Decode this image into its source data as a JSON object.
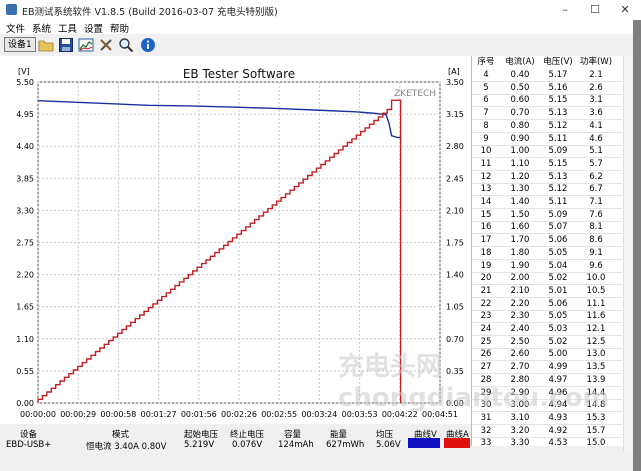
{
  "window": {
    "title": "EB测试系统软件 V1.8.5 (Build 2016-03-07 充电头特别版)",
    "controls": [
      "–",
      "☐",
      "✕"
    ]
  },
  "menu": [
    "文件",
    "系统",
    "工具",
    "设置",
    "帮助"
  ],
  "toolbar": {
    "device_button": "设备1",
    "icons": [
      "folder-icon",
      "save-icon",
      "chart-icon",
      "tools-icon",
      "zoom-icon",
      "info-icon"
    ]
  },
  "chart_data": {
    "type": "line",
    "title": "EB Tester Software",
    "watermark": "ZKETECH",
    "left_unit": "[V]",
    "right_unit": "[A]",
    "y_left_ticks": [
      "5.50",
      "4.95",
      "4.40",
      "3.85",
      "3.30",
      "2.75",
      "2.20",
      "1.65",
      "1.10",
      "0.55",
      "0.00"
    ],
    "y_right_ticks": [
      "3.50",
      "3.15",
      "2.80",
      "2.45",
      "2.10",
      "1.75",
      "1.40",
      "1.05",
      "0.70",
      "0.35",
      "0.00"
    ],
    "x_ticks": [
      "00:00:00",
      "00:00:29",
      "00:00:58",
      "00:01:27",
      "00:01:56",
      "00:02:26",
      "00:02:55",
      "00:03:24",
      "00:03:53",
      "00:04:22",
      "00:04:51"
    ],
    "ylim_left": [
      0,
      5.5
    ],
    "ylim_right": [
      0,
      3.5
    ],
    "xlim_seconds": [
      0,
      291
    ],
    "grid": true,
    "series": [
      {
        "color": "#1f2fa0",
        "axis": "left",
        "x": [
          0,
          20,
          50,
          80,
          110,
          140,
          170,
          200,
          230,
          245,
          252,
          254,
          256,
          260,
          263
        ],
        "values": [
          5.18,
          5.16,
          5.13,
          5.1,
          5.09,
          5.07,
          5.05,
          5.02,
          4.99,
          4.96,
          4.94,
          4.8,
          4.58,
          4.55,
          4.55
        ]
      },
      {
        "color": "#c02020",
        "axis": "right",
        "step_current": true,
        "x": [
          0,
          3.2,
          6.4,
          9.6,
          12.8,
          16.0,
          19.2,
          22.4,
          25.6,
          28.8,
          32.0,
          35.2,
          38.4,
          41.6,
          44.8,
          48.0,
          51.2,
          54.4,
          57.6,
          60.8,
          64.0,
          67.2,
          70.4,
          73.6,
          76.8,
          80.0,
          83.2,
          86.4,
          89.6,
          92.8,
          96.0,
          99.2,
          102.4,
          105.6,
          108.8,
          112.0,
          115.2,
          118.4,
          121.6,
          124.8,
          128.0,
          131.2,
          134.4,
          137.6,
          140.8,
          144.0,
          147.2,
          150.4,
          153.6,
          156.8,
          160.0,
          163.2,
          166.4,
          169.6,
          172.8,
          176.0,
          179.2,
          182.4,
          185.6,
          188.8,
          192.0,
          195.2,
          198.4,
          201.6,
          204.8,
          208.0,
          211.2,
          214.4,
          217.6,
          220.8,
          224.0,
          227.2,
          230.4,
          233.6,
          236.8,
          240.0,
          243.2,
          246.4,
          249.6,
          252.8,
          256.0,
          259.2,
          262.0,
          262.5
        ],
        "values": [
          0.04,
          0.08,
          0.12,
          0.16,
          0.2,
          0.24,
          0.28,
          0.32,
          0.36,
          0.4,
          0.44,
          0.48,
          0.52,
          0.56,
          0.6,
          0.64,
          0.68,
          0.72,
          0.76,
          0.8,
          0.84,
          0.88,
          0.92,
          0.96,
          1.0,
          1.04,
          1.08,
          1.12,
          1.16,
          1.2,
          1.24,
          1.28,
          1.32,
          1.36,
          1.4,
          1.44,
          1.48,
          1.52,
          1.56,
          1.6,
          1.64,
          1.68,
          1.72,
          1.76,
          1.8,
          1.84,
          1.88,
          1.92,
          1.96,
          2.0,
          2.04,
          2.08,
          2.12,
          2.16,
          2.2,
          2.24,
          2.28,
          2.32,
          2.36,
          2.4,
          2.44,
          2.48,
          2.52,
          2.56,
          2.6,
          2.64,
          2.68,
          2.72,
          2.76,
          2.8,
          2.84,
          2.88,
          2.92,
          2.96,
          3.0,
          3.04,
          3.08,
          3.12,
          3.16,
          3.2,
          3.3,
          3.3,
          3.3,
          0.0
        ]
      }
    ]
  },
  "table": {
    "headers": [
      "序号",
      "电流(A)",
      "电压(V)",
      "功率(W)"
    ],
    "rows": [
      [
        "4",
        "0.40",
        "5.17",
        "2.1"
      ],
      [
        "5",
        "0.50",
        "5.16",
        "2.6"
      ],
      [
        "6",
        "0.60",
        "5.15",
        "3.1"
      ],
      [
        "7",
        "0.70",
        "5.13",
        "3.6"
      ],
      [
        "8",
        "0.80",
        "5.12",
        "4.1"
      ],
      [
        "9",
        "0.90",
        "5.11",
        "4.6"
      ],
      [
        "10",
        "1.00",
        "5.09",
        "5.1"
      ],
      [
        "11",
        "1.10",
        "5.15",
        "5.7"
      ],
      [
        "12",
        "1.20",
        "5.13",
        "6.2"
      ],
      [
        "13",
        "1.30",
        "5.12",
        "6.7"
      ],
      [
        "14",
        "1.40",
        "5.11",
        "7.1"
      ],
      [
        "15",
        "1.50",
        "5.09",
        "7.6"
      ],
      [
        "16",
        "1.60",
        "5.07",
        "8.1"
      ],
      [
        "17",
        "1.70",
        "5.06",
        "8.6"
      ],
      [
        "18",
        "1.80",
        "5.05",
        "9.1"
      ],
      [
        "19",
        "1.90",
        "5.04",
        "9.6"
      ],
      [
        "20",
        "2.00",
        "5.02",
        "10.0"
      ],
      [
        "21",
        "2.10",
        "5.01",
        "10.5"
      ],
      [
        "22",
        "2.20",
        "5.06",
        "11.1"
      ],
      [
        "23",
        "2.30",
        "5.05",
        "11.6"
      ],
      [
        "24",
        "2.40",
        "5.03",
        "12.1"
      ],
      [
        "25",
        "2.50",
        "5.02",
        "12.5"
      ],
      [
        "26",
        "2.60",
        "5.00",
        "13.0"
      ],
      [
        "27",
        "2.70",
        "4.99",
        "13.5"
      ],
      [
        "28",
        "2.80",
        "4.97",
        "13.9"
      ],
      [
        "29",
        "2.90",
        "4.96",
        "14.4"
      ],
      [
        "30",
        "3.00",
        "4.94",
        "14.8"
      ],
      [
        "31",
        "3.10",
        "4.93",
        "15.3"
      ],
      [
        "32",
        "3.20",
        "4.92",
        "15.7"
      ],
      [
        "33",
        "3.30",
        "4.53",
        "15.0"
      ]
    ]
  },
  "status": {
    "headers": [
      "设备",
      "模式",
      "起始电压",
      "终止电压",
      "容量",
      "能量",
      "均压",
      "曲线V",
      "曲线A"
    ],
    "values": [
      "EBD-USB+",
      "恒电流  3.40A  0.80V",
      "5.219V",
      "0.076V",
      "124mAh",
      "627mWh",
      "5.06V"
    ],
    "curve_colors": [
      "#1010c0",
      "#e01010"
    ]
  },
  "overlay_watermark": "充电头网 chongdiantou.com"
}
